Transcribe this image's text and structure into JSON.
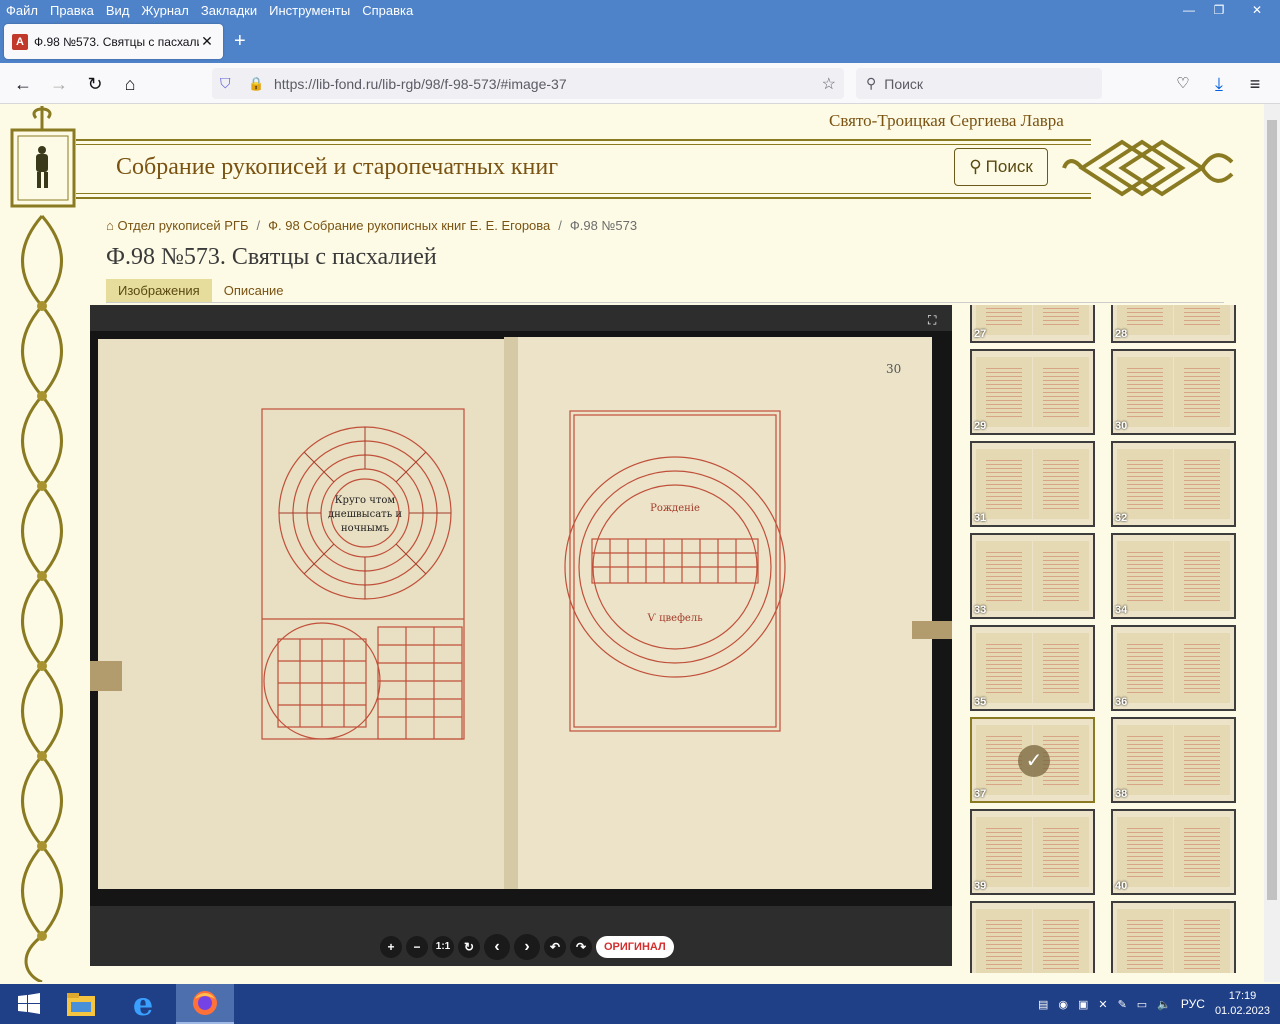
{
  "browser": {
    "menu": [
      "Файл",
      "Правка",
      "Вид",
      "Журнал",
      "Закладки",
      "Инструменты",
      "Справка"
    ],
    "tab_title": "Ф.98 №573. Святцы с пасхалие",
    "url": "https://lib-fond.ru/lib-rgb/98/f-98-573/#image-37",
    "search_placeholder": "Поиск"
  },
  "site": {
    "monastery": "Свято-Троицкая Сергиева Лавра",
    "title": "Собрание рукописей и старопечатных книг",
    "search_button": "Поиск"
  },
  "breadcrumb": [
    "Отдел рукописей РГБ",
    "Ф. 98 Собрание рукописных книг Е. Е. Егорова",
    "Ф.98 №573"
  ],
  "page_title": "Ф.98 №573. Святцы с пасхалией",
  "tabs": [
    "Изображения",
    "Описание"
  ],
  "viewer": {
    "folio_number": "30",
    "controls": [
      "+",
      "−",
      "1:1",
      "↻",
      "‹",
      "›",
      "↶",
      "↷"
    ],
    "original_button": "ОРИГИНАЛ",
    "left_circle_text": "Круго чтом днешвысать и ночнымъ",
    "right_top_label": "Рожденіе",
    "right_bottom_label": "Ѵ цвефель"
  },
  "thumbnails": [
    {
      "n": "27"
    },
    {
      "n": "28"
    },
    {
      "n": "29"
    },
    {
      "n": "30"
    },
    {
      "n": "31"
    },
    {
      "n": "32"
    },
    {
      "n": "33"
    },
    {
      "n": "34"
    },
    {
      "n": "35"
    },
    {
      "n": "36"
    },
    {
      "n": "37",
      "selected": true
    },
    {
      "n": "38"
    },
    {
      "n": "39"
    },
    {
      "n": "40"
    },
    {
      "n": ""
    },
    {
      "n": ""
    }
  ],
  "taskbar": {
    "lang": "РУС",
    "time": "17:19",
    "date": "01.02.2023"
  }
}
